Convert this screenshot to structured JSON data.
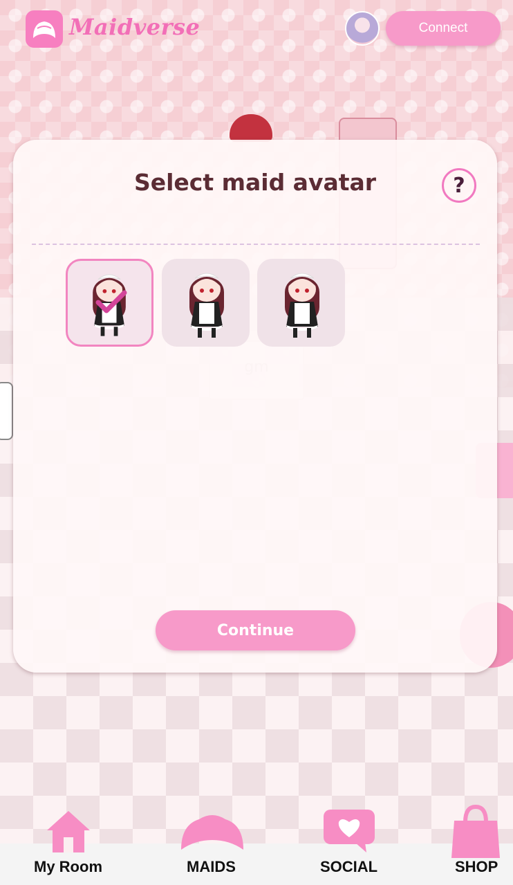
{
  "app": {
    "title": "Maidverse"
  },
  "header": {
    "connect_label": "Connect"
  },
  "modal": {
    "title": "Select maid avatar",
    "help_label": "?",
    "continue_label": "Continue",
    "avatars": [
      {
        "selected": true
      },
      {
        "selected": false
      },
      {
        "selected": false
      }
    ]
  },
  "scene": {
    "speech_text": "gm"
  },
  "nav": {
    "items": [
      {
        "label": "My Room",
        "icon": "house-icon"
      },
      {
        "label": "MAIDS",
        "icon": "maid-headband-icon"
      },
      {
        "label": "SOCIAL",
        "icon": "heart-chat-icon"
      },
      {
        "label": "SHOP",
        "icon": "shopping-bag-icon"
      }
    ]
  },
  "colors": {
    "accent": "#f79ac9",
    "brand": "#f26fb7",
    "title": "#5b2c34"
  }
}
